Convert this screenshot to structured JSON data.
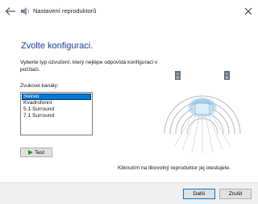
{
  "window": {
    "title": "Nastavení reproduktorů",
    "back_icon": "back-arrow-icon",
    "close_icon": "close-icon"
  },
  "main": {
    "heading": "Zvolte konfiguraci.",
    "description": "Vyberte typ ozvučení, který nejlépe odpovídá konfiguraci v počítači.",
    "channels_label": "Zvukové kanály:",
    "channels": [
      {
        "label": "Stereo",
        "selected": true
      },
      {
        "label": "Kvadrofonní",
        "selected": false
      },
      {
        "label": "5.1 Surround",
        "selected": false
      },
      {
        "label": "7.1 Surround",
        "selected": false
      }
    ],
    "test_label": "Test",
    "hint": "Kliknutím na libovolný reproduktor jej otestujete."
  },
  "footer": {
    "next_label": "Další",
    "cancel_label": "Zrušit"
  },
  "colors": {
    "heading": "#1a3c8f",
    "selection": "#0078d7",
    "footer_bg": "#f0f0f0"
  }
}
